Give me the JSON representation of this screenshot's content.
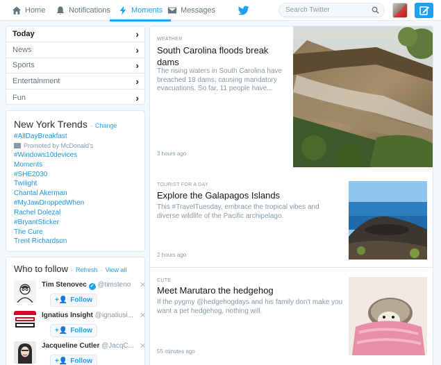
{
  "nav": {
    "home": "Home",
    "notifications": "Notifications",
    "moments": "Moments",
    "messages": "Messages",
    "search_placeholder": "Search Twitter"
  },
  "categories": [
    {
      "label": "Today"
    },
    {
      "label": "News"
    },
    {
      "label": "Sports"
    },
    {
      "label": "Entertainment"
    },
    {
      "label": "Fun"
    }
  ],
  "trends": {
    "title": "New York Trends",
    "change": "Change",
    "promoted_tag": "#AllDayBreakfast",
    "promoted_by": "Promoted by McDonald's",
    "items": [
      "#Windows10devices",
      "Moments",
      "#SHE2030",
      "Twilight",
      "Chantal Akerman",
      "#MyJawDroppedWhen",
      "Rachel Dolezal",
      "#BryantSticker",
      "The Cure",
      "Trent Richardson"
    ]
  },
  "who_to_follow": {
    "title": "Who to follow",
    "refresh": "Refresh",
    "view_all": "View all",
    "follow_label": "Follow",
    "users": [
      {
        "name": "Tim Stenovec",
        "handle": "@timsteno",
        "verified": true
      },
      {
        "name": "Ignatius Insight",
        "handle": "@ignatiusi...",
        "verified": false
      },
      {
        "name": "Jacqueline Cutler",
        "handle": "@JacqC...",
        "verified": false
      }
    ]
  },
  "moments": [
    {
      "category": "WEATHER",
      "title": "South Carolina floods break dams",
      "desc": "The rising waters in South Carolina have breached 18 dams, causing mandatory evacuations. So far, 11 people have...",
      "time": "3 hours ago"
    },
    {
      "category": "TOURIST FOR A DAY",
      "title": "Explore the Galapagos Islands",
      "desc": "This #TravelTuesday, embrace the tropical vibes and diverse wildlife of the Pacific archipelago.",
      "time": "2 hours ago"
    },
    {
      "category": "CUTE",
      "title": "Meet Marutaro the hedgehog",
      "desc": "If the pygmy @hedgehogdays and his family don't make you want a pet hedgehog, nothing will.",
      "time": "55 minutes ago"
    }
  ],
  "colors": {
    "accent": "#1da1f2",
    "link": "#1b95e0",
    "background": "#f5f8fa",
    "border": "#e1e8ed"
  },
  "icons": [
    "home-icon",
    "bell-icon",
    "lightning-icon",
    "envelope-icon",
    "bird-icon",
    "search-icon",
    "compose-icon",
    "chevron-right-icon",
    "close-icon",
    "add-user-icon"
  ]
}
